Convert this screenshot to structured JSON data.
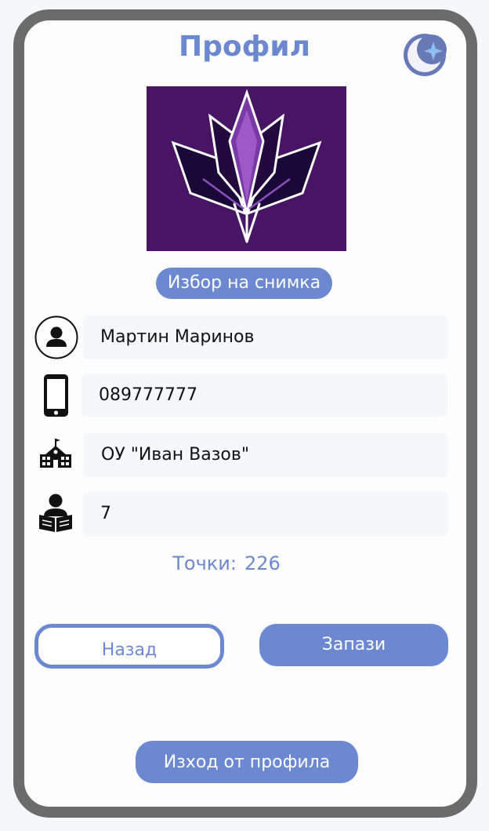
{
  "header": {
    "title": "Профил",
    "theme_toggle_icon": "moon-sparkle-icon"
  },
  "profile_image": {
    "icon": "lotus-logo-icon",
    "background_color": "#471563"
  },
  "pick_photo_label": "Избор на снимка",
  "fields": {
    "name": {
      "icon": "user-circle-icon",
      "value": "Мартин Маринов"
    },
    "phone": {
      "icon": "smartphone-icon",
      "value": "089777777"
    },
    "school": {
      "icon": "school-building-icon",
      "value": "ОУ \"Иван Вазов\""
    },
    "grade": {
      "icon": "reader-icon",
      "value": "7"
    }
  },
  "points": {
    "label": "Точки:",
    "value": "226"
  },
  "actions": {
    "back_label": "Назад",
    "save_label": "Запази",
    "logout_label": "Изход от профила"
  },
  "colors": {
    "accent": "#6b88d1",
    "device_frame": "#6b6b6b",
    "field_background": "#f6f7fa"
  }
}
